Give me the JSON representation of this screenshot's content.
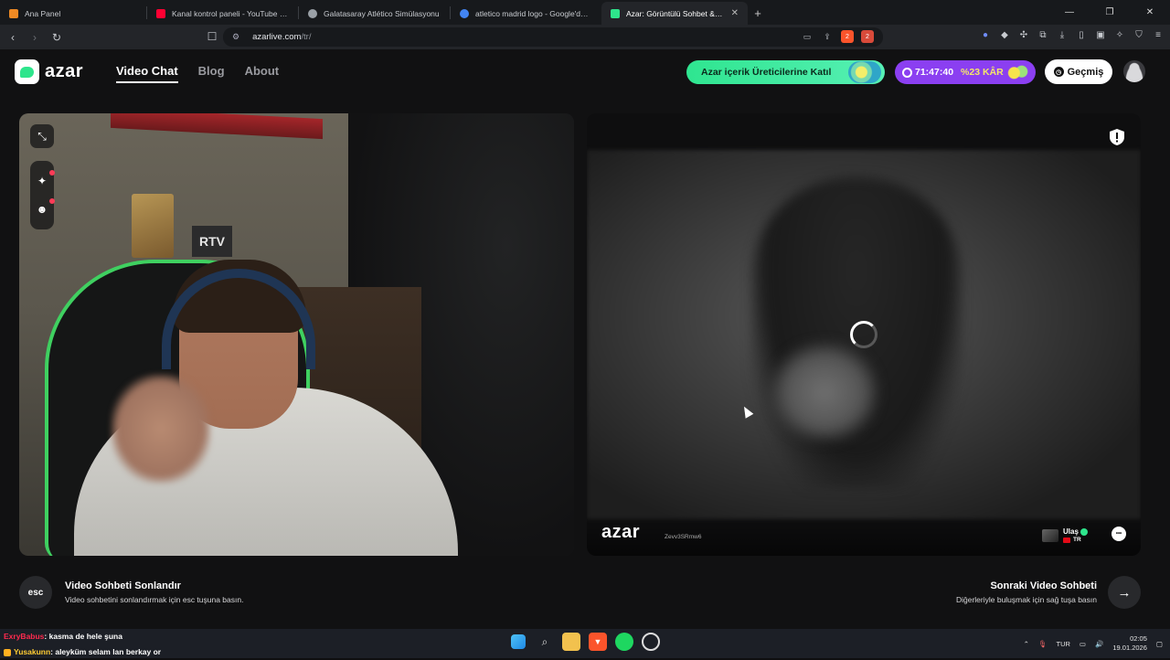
{
  "browser": {
    "tabs": [
      {
        "label": "Ana Panel",
        "color": "#f08a24"
      },
      {
        "label": "Kanal kontrol paneli - YouTube Studio",
        "color": "#ff0033"
      },
      {
        "label": "Galatasaray Atlético Simülasyonu",
        "color": "#9aa0a6"
      },
      {
        "label": "atletico madrid logo - Google'da Ara",
        "color": "#4285f4"
      },
      {
        "label": "Azar: Görüntülü Sohbet & Ye",
        "color": "#2ee58c"
      }
    ],
    "url_host": "azarlive.com",
    "url_path": "/tr/",
    "shield_count": "2",
    "rewards_count": "2"
  },
  "header": {
    "logo": "azar",
    "nav": [
      "Video Chat",
      "Blog",
      "About"
    ],
    "creator_cta": "Azar içerik Üreticilerine Katıl",
    "timer": "71:47:40",
    "profit": "%23 KÂR",
    "history": "Geçmiş"
  },
  "local": {
    "rtv_sign": "RTV"
  },
  "remote": {
    "watermark": "azar",
    "peer_id": "Zevv3SRmw6",
    "peer_name": "Ulaş",
    "peer_country": "TR"
  },
  "controls": {
    "esc_key": "esc",
    "end_title": "Video Sohbeti Sonlandır",
    "end_sub": "Video sohbetini sonlandırmak için esc tuşuna basın.",
    "next_title": "Sonraki Video Sohbeti",
    "next_sub": "Diğerleriyle buluşmak için sağ tuşa basın"
  },
  "stream_chat": [
    {
      "user": "ExryBabus",
      "message": ": kasma de hele şuna"
    },
    {
      "user": "Yusakunn",
      "message": ": aleyküm selam lan berkay or"
    }
  ],
  "taskbar": {
    "lang": "TUR",
    "time": "02:05",
    "date": "19.01.2026"
  },
  "colors": {
    "brand_green": "#2ee58c",
    "timer_purple": "#8b3ff1"
  }
}
